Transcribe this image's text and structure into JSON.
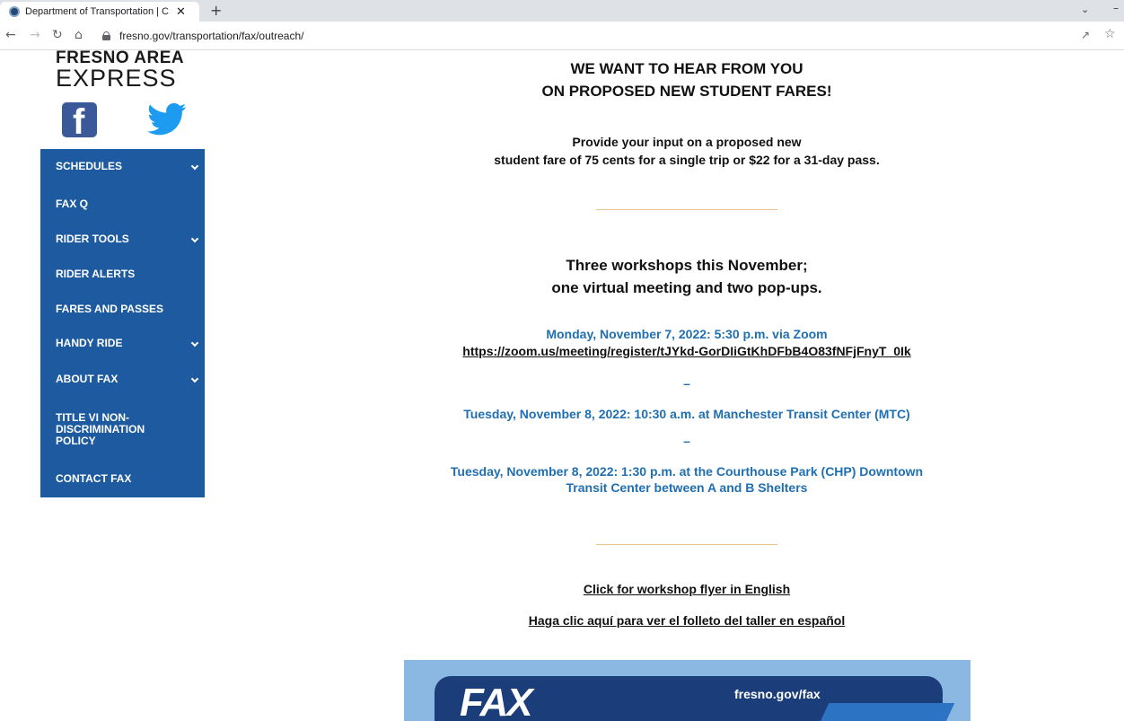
{
  "browser": {
    "tab_title": "Department of Transportation | C",
    "tab_close": "✕",
    "new_tab": "+",
    "url": "fresno.gov/transportation/fax/outreach/"
  },
  "sidebar": {
    "logo_top": "FRESNO AREA",
    "logo_bottom": "EXPRESS",
    "social": [
      "facebook-icon",
      "twitter-icon"
    ],
    "items": [
      {
        "label": "SCHEDULES",
        "has_submenu": true
      },
      {
        "label": "FAX Q",
        "has_submenu": false
      },
      {
        "label": "RIDER TOOLS",
        "has_submenu": true
      },
      {
        "label": "RIDER ALERTS",
        "has_submenu": false
      },
      {
        "label": "FARES AND PASSES",
        "has_submenu": false
      },
      {
        "label": "HANDY RIDE",
        "has_submenu": true
      },
      {
        "label": "ABOUT FAX",
        "has_submenu": true
      },
      {
        "label": "TITLE VI NON-DISCRIMINATION POLICY",
        "has_submenu": false
      },
      {
        "label": "CONTACT FAX",
        "has_submenu": false
      }
    ],
    "nav_color": "#1e5aa0"
  },
  "main": {
    "heading_line1": "WE WANT TO HEAR FROM YOU",
    "heading_line2": "ON PROPOSED NEW STUDENT FARES!",
    "intro_line1": "Provide your input on a proposed new",
    "intro_line2": "student fare of 75 cents for a single trip or $22 for a 31-day pass.",
    "workshops_line1": "Three workshops this November;",
    "workshops_line2": "one virtual meeting and two pop-ups.",
    "events": [
      {
        "text": "Monday, November 7, 2022: 5:30 p.m. via Zoom",
        "link": "https://zoom.us/meeting/register/tJYkd-GorDIiGtKhDFbB4O83fNFjFnyT_0Ik"
      },
      {
        "text": "Tuesday, November 8, 2022: 10:30 a.m. at Manchester Transit Center (MTC)"
      },
      {
        "text_line1": "Tuesday, November 8, 2022: 1:30 p.m. at the Courthouse Park (CHP) Downtown",
        "text_line2": "Transit Center between A and B Shelters"
      }
    ],
    "separator": "–",
    "flyer_english": "Click for workshop flyer in English",
    "flyer_spanish": "Haga clic aquí para ver el folleto del taller en español",
    "accent_color": "#1f6fb2",
    "divider_color": "#e8c48a"
  },
  "banner": {
    "logo": "FAX",
    "url": "fresno.gov/fax"
  }
}
